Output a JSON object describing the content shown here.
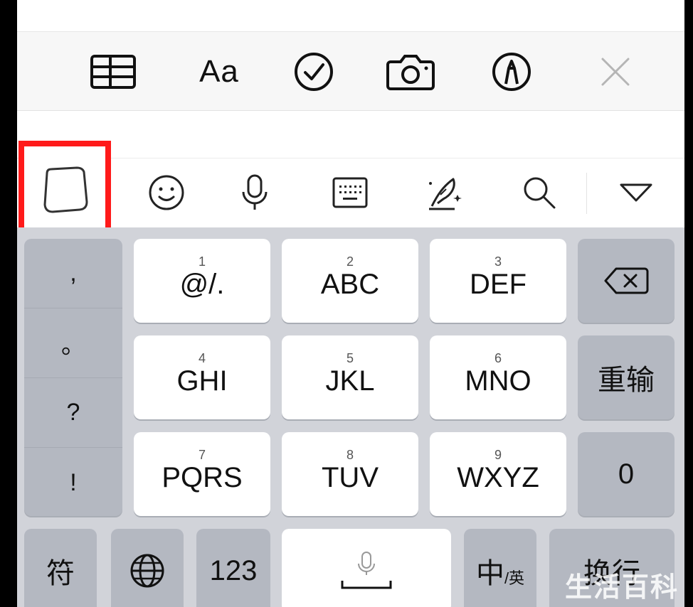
{
  "toolbar": {
    "items": [
      "table-icon",
      "Aa",
      "checklist-icon",
      "camera-icon",
      "markup-icon",
      "close-icon"
    ],
    "format_label": "Aa"
  },
  "ime_bar": {
    "items": [
      "sticker-icon",
      "emoji-icon",
      "microphone-icon",
      "keyboard-icon",
      "handwriting-icon",
      "search-icon",
      "collapse-icon"
    ]
  },
  "keyboard": {
    "punctuation": [
      ",",
      "。",
      "?",
      "!"
    ],
    "keys": [
      {
        "num": "1",
        "label": "@/."
      },
      {
        "num": "2",
        "label": "ABC"
      },
      {
        "num": "3",
        "label": "DEF"
      },
      {
        "num": "4",
        "label": "GHI"
      },
      {
        "num": "5",
        "label": "JKL"
      },
      {
        "num": "6",
        "label": "MNO"
      },
      {
        "num": "7",
        "label": "PQRS"
      },
      {
        "num": "8",
        "label": "TUV"
      },
      {
        "num": "9",
        "label": "WXYZ"
      }
    ],
    "reenter_label": "重输",
    "zero_label": "0",
    "symbol_label": "符",
    "numbers_label": "123",
    "lang_main": "中",
    "lang_alt": "/英",
    "return_label": "换行"
  },
  "watermark": "生活百科",
  "colors": {
    "highlight": "#ff1a1a",
    "keyboard_bg": "#d1d3d9",
    "dark_key": "#b4b8c1"
  }
}
